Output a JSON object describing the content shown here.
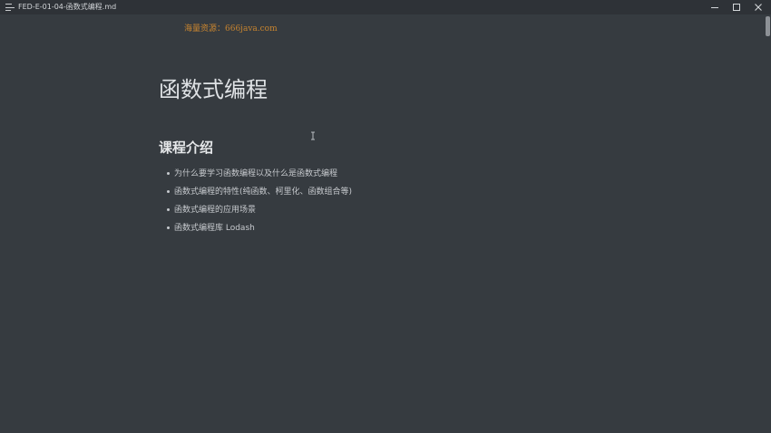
{
  "titlebar": {
    "title": "FED-E-01-04-函数式编程.md",
    "icons": {
      "menu": "hamburger-menu-icon",
      "minimize": "minimize-icon",
      "maximize": "maximize-icon",
      "close": "close-icon"
    }
  },
  "watermark": {
    "text": "海量资源：666java.com"
  },
  "document": {
    "title": "函数式编程",
    "section_heading": "课程介绍",
    "items": [
      "为什么要学习函数编程以及什么是函数式编程",
      "函数式编程的特性(纯函数、柯里化、函数组合等)",
      "函数式编程的应用场景",
      "函数式编程库 Lodash"
    ]
  },
  "colors": {
    "background": "#363b40",
    "titlebar": "#2e3237",
    "heading": "#dfe2e5",
    "text": "#c7cace",
    "watermark": "#c9852f"
  }
}
